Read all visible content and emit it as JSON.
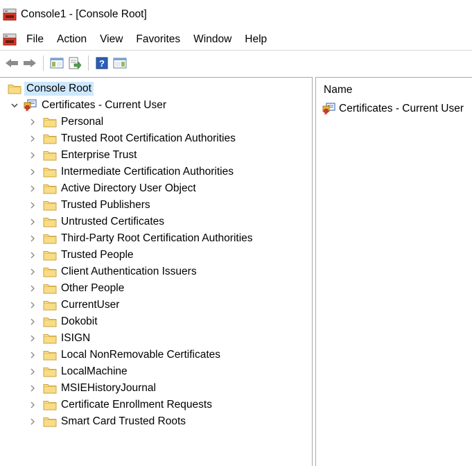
{
  "window": {
    "title": "Console1 - [Console Root]"
  },
  "menu": [
    "File",
    "Action",
    "View",
    "Favorites",
    "Window",
    "Help"
  ],
  "tree": {
    "root": "Console Root",
    "store": "Certificates - Current User",
    "folders": [
      "Personal",
      "Trusted Root Certification Authorities",
      "Enterprise Trust",
      "Intermediate Certification Authorities",
      "Active Directory User Object",
      "Trusted Publishers",
      "Untrusted Certificates",
      "Third-Party Root Certification Authorities",
      "Trusted People",
      "Client Authentication Issuers",
      "Other People",
      "CurrentUser",
      "Dokobit",
      "ISIGN",
      "Local NonRemovable Certificates",
      "LocalMachine",
      "MSIEHistoryJournal",
      "Certificate Enrollment Requests",
      "Smart Card Trusted Roots"
    ]
  },
  "details": {
    "column_name": "Name",
    "items": [
      "Certificates - Current User"
    ]
  },
  "colors": {
    "selection": "#cce8ff",
    "folder": "#f5d77a",
    "border": "#a9a9a9"
  }
}
